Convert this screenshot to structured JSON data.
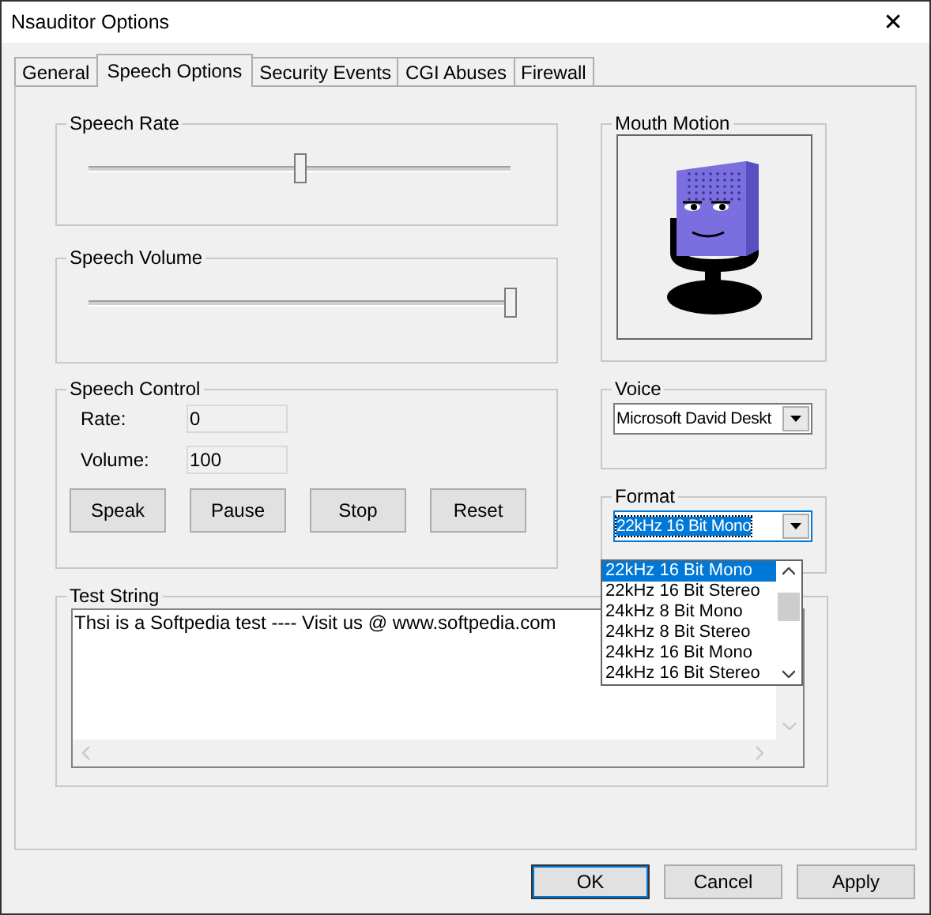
{
  "window": {
    "title": "Nsauditor Options",
    "close": "✕"
  },
  "tabs": [
    {
      "label": "General",
      "selected": false
    },
    {
      "label": "Speech Options",
      "selected": true
    },
    {
      "label": "Security Events",
      "selected": false
    },
    {
      "label": "CGI Abuses",
      "selected": false
    },
    {
      "label": "Firewall",
      "selected": false
    }
  ],
  "speech_rate": {
    "title": "Speech Rate",
    "level": 0.5
  },
  "speech_volume": {
    "title": "Speech Volume",
    "level": 1.0
  },
  "speech_control": {
    "title": "Speech Control",
    "fields": [
      {
        "label": "Rate:",
        "value": "0"
      },
      {
        "label": "Volume:",
        "value": "100"
      }
    ],
    "buttons": [
      "Speak",
      "Pause",
      "Stop",
      "Reset"
    ]
  },
  "mouth_motion": {
    "title": "Mouth Motion"
  },
  "voice": {
    "title": "Voice",
    "value": "Microsoft David Deskt"
  },
  "format": {
    "title": "Format",
    "value": "22kHz 16 Bit Mono",
    "expanded": true,
    "options": [
      {
        "label": "22kHz 16 Bit Mono",
        "selected": true
      },
      {
        "label": "22kHz 16 Bit Stereo",
        "selected": false
      },
      {
        "label": "24kHz 8 Bit Mono",
        "selected": false
      },
      {
        "label": "24kHz 8 Bit Stereo",
        "selected": false
      },
      {
        "label": "24kHz 16 Bit Mono",
        "selected": false
      },
      {
        "label": "24kHz 16 Bit Stereo",
        "selected": false
      }
    ]
  },
  "test_string": {
    "title": "Test String",
    "value": "Thsi is a Softpedia test ---- Visit us @ www.softpedia.com"
  },
  "buttons": [
    "OK",
    "Cancel",
    "Apply"
  ]
}
